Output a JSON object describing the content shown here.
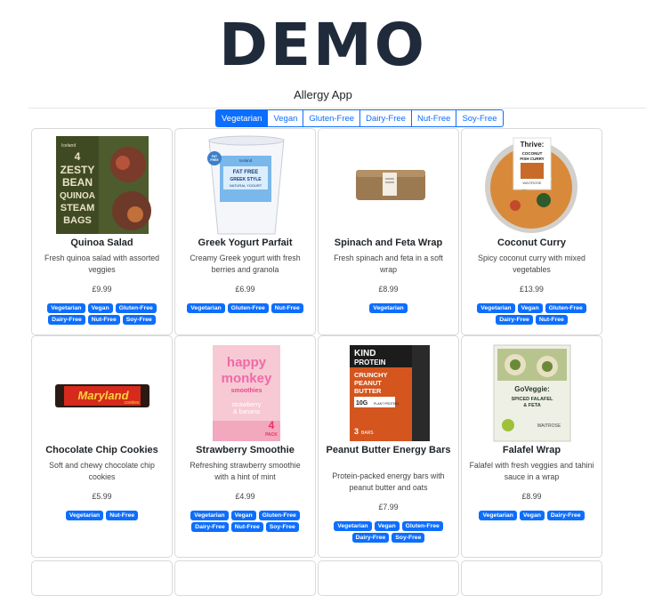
{
  "brand": "DEMO",
  "app_title": "Allergy App",
  "accent_color": "#0d6efd",
  "filters": [
    {
      "label": "Vegetarian",
      "active": true
    },
    {
      "label": "Vegan",
      "active": false
    },
    {
      "label": "Gluten-Free",
      "active": false
    },
    {
      "label": "Dairy-Free",
      "active": false
    },
    {
      "label": "Nut-Free",
      "active": false
    },
    {
      "label": "Soy-Free",
      "active": false
    }
  ],
  "products": [
    {
      "name": "Quinoa Salad",
      "description": "Fresh quinoa salad with assorted veggies",
      "price": "£9.99",
      "tags": [
        "Vegetarian",
        "Vegan",
        "Gluten-Free",
        "Dairy-Free",
        "Nut-Free",
        "Soy-Free"
      ],
      "image_icon": "quinoa-bag-image",
      "image_text": [
        "Iceland",
        "4",
        "ZESTY",
        "BEAN",
        "QUINOA",
        "STEAM",
        "BAGS"
      ]
    },
    {
      "name": "Greek Yogurt Parfait",
      "description": "Creamy Greek yogurt with fresh berries and granola",
      "price": "£6.99",
      "tags": [
        "Vegetarian",
        "Gluten-Free",
        "Nut-Free"
      ],
      "image_icon": "yogurt-tub-image",
      "image_text": [
        "FAT",
        "FREE",
        "Iceland",
        "FAT FREE",
        "GREEK STYLE",
        "NATURAL YOGURT"
      ]
    },
    {
      "name": "Spinach and Feta Wrap",
      "description": "Fresh spinach and feta in a soft wrap",
      "price": "£8.99",
      "tags": [
        "Vegetarian"
      ],
      "image_icon": "wrap-image",
      "image_text": []
    },
    {
      "name": "Coconut Curry",
      "description": "Spicy coconut curry with mixed vegetables",
      "price": "£13.99",
      "tags": [
        "Vegetarian",
        "Vegan",
        "Gluten-Free",
        "Dairy-Free",
        "Nut-Free"
      ],
      "image_icon": "curry-bowl-image",
      "image_text": [
        "Thrive:",
        "COCONUT",
        "FISH CURRY",
        "WAITROSE"
      ]
    },
    {
      "name": "Chocolate Chip Cookies",
      "description": "Soft and chewy chocolate chip cookies",
      "price": "£5.99",
      "tags": [
        "Vegetarian",
        "Nut-Free"
      ],
      "image_icon": "cookie-pack-image",
      "image_text": [
        "Maryland",
        "cookies"
      ]
    },
    {
      "name": "Strawberry Smoothie",
      "description": "Refreshing strawberry smoothie with a hint of mint",
      "price": "£4.99",
      "tags": [
        "Vegetarian",
        "Vegan",
        "Gluten-Free",
        "Dairy-Free",
        "Nut-Free",
        "Soy-Free"
      ],
      "image_icon": "smoothie-box-image",
      "image_text": [
        "happy",
        "monkey",
        "smoothies",
        "strawberry",
        "& banana",
        "4",
        "PACK"
      ]
    },
    {
      "name": "Peanut Butter Energy Bars",
      "description": "Protein-packed energy bars with peanut butter and oats",
      "price": "£7.99",
      "tags": [
        "Vegetarian",
        "Vegan",
        "Gluten-Free",
        "Dairy-Free",
        "Soy-Free"
      ],
      "image_icon": "protein-bar-image",
      "image_text": [
        "KIND",
        "PROTEIN",
        "CRUNCHY",
        "PEANUT",
        "BUTTER",
        "10G",
        "PLANT PROTEIN",
        "3",
        "BARS"
      ]
    },
    {
      "name": "Falafel Wrap",
      "description": "Falafel with fresh veggies and tahini sauce in a wrap",
      "price": "£8.99",
      "tags": [
        "Vegetarian",
        "Vegan",
        "Dairy-Free"
      ],
      "image_icon": "falafel-wrap-image",
      "image_text": [
        "GoVeggie:",
        "SPICED FALAFEL",
        "& FETA",
        "WAITROSE"
      ]
    }
  ]
}
